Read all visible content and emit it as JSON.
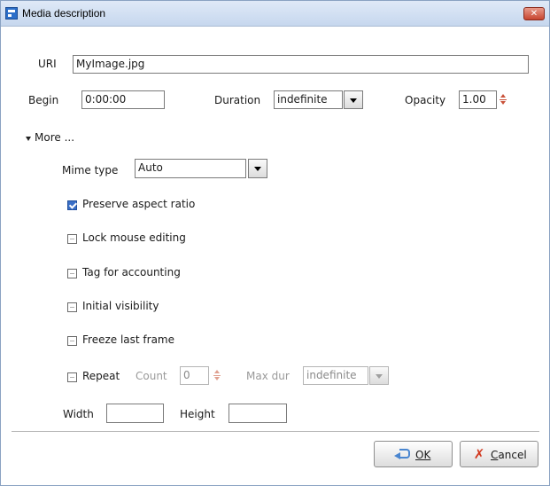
{
  "window": {
    "title": "Media description",
    "close_glyph": "✕"
  },
  "uri": {
    "label": "URI",
    "value": "MyImage.jpg"
  },
  "timing": {
    "begin_label": "Begin",
    "begin_value": "0:00:00",
    "duration_label": "Duration",
    "duration_value": "indefinite",
    "opacity_label": "Opacity",
    "opacity_value": "1.00"
  },
  "more": {
    "label": "More ..."
  },
  "mime": {
    "label": "Mime type",
    "value": "Auto"
  },
  "options": [
    {
      "label": "Preserve aspect ratio",
      "checked": true
    },
    {
      "label": "Lock mouse editing",
      "checked": false
    },
    {
      "label": "Tag for accounting",
      "checked": false
    },
    {
      "label": "Initial visibility",
      "checked": false
    },
    {
      "label": "Freeze last frame",
      "checked": false
    }
  ],
  "repeat": {
    "label": "Repeat",
    "checked": false,
    "count_label": "Count",
    "count_value": "0",
    "maxdur_label": "Max dur",
    "maxdur_value": "indefinite"
  },
  "size": {
    "width_label": "Width",
    "width_value": "",
    "height_label": "Height",
    "height_value": ""
  },
  "buttons": {
    "ok_label": "OK",
    "cancel_label": "Cancel"
  },
  "icons": {
    "title": "media-window-icon",
    "close": "close-icon",
    "ok": "ok-arrow-icon",
    "cancel": "cancel-x-icon"
  },
  "colors": {
    "titlebar": "#c6d7ee",
    "close_button": "#c7452f",
    "checkbox_checked": "#3a6fc7",
    "spinner": "#c9523a"
  }
}
